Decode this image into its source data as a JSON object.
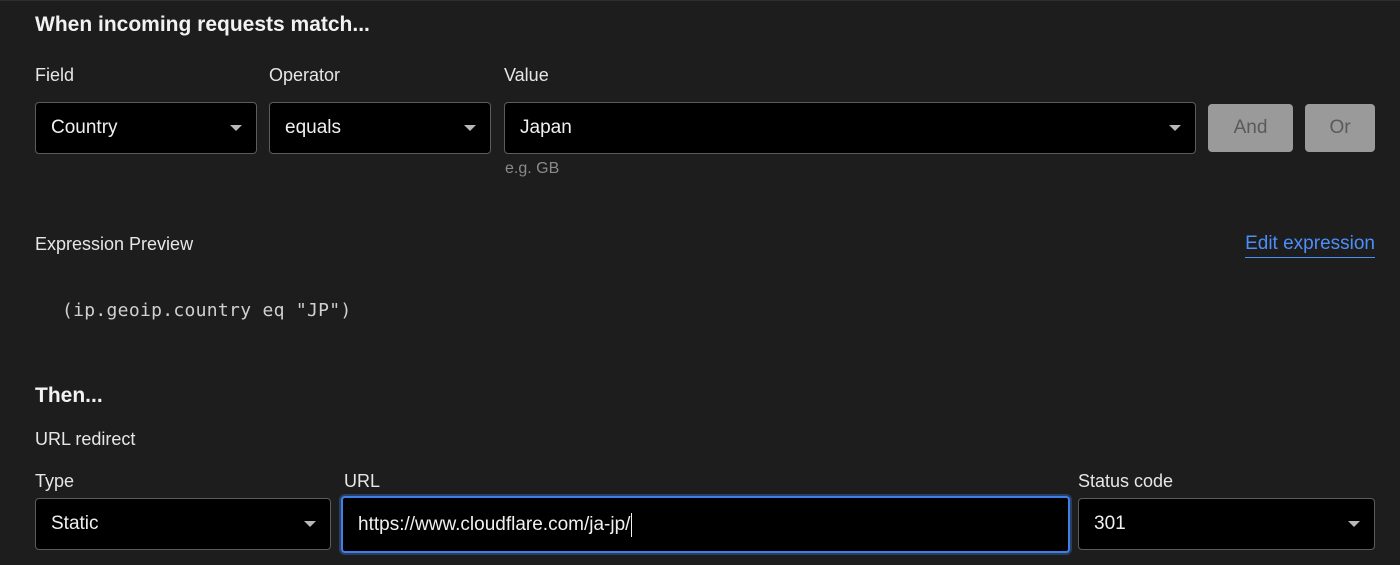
{
  "match_section": {
    "heading": "When incoming requests match...",
    "field_label": "Field",
    "operator_label": "Operator",
    "value_label": "Value",
    "field_value": "Country",
    "operator_value": "equals",
    "value_value": "Japan",
    "value_hint": "e.g. GB",
    "and_label": "And",
    "or_label": "Or"
  },
  "expression": {
    "label": "Expression Preview",
    "edit_link": "Edit expression",
    "code": "(ip.geoip.country eq \"JP\")"
  },
  "then_section": {
    "heading": "Then...",
    "action": "URL redirect",
    "type_label": "Type",
    "url_label": "URL",
    "status_label": "Status code",
    "type_value": "Static",
    "url_value": "https://www.cloudflare.com/ja-jp/",
    "status_value": "301"
  },
  "colors": {
    "background": "#1d1d1d",
    "input_background": "#000000",
    "focus_border": "#3f7fe8",
    "link": "#4c8ff8",
    "disabled_button": "#9a9a9a"
  },
  "icons": {
    "dropdown": "caret-down-icon"
  }
}
